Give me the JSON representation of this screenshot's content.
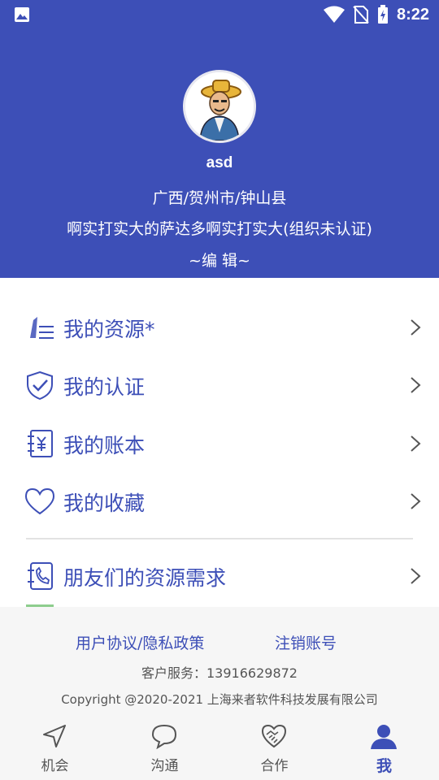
{
  "status_bar": {
    "time": "8:22",
    "left_icon": "image-icon",
    "right_icons": [
      "wifi-icon",
      "no-sim-icon",
      "battery-charging-icon"
    ]
  },
  "profile": {
    "username": "asd",
    "location": "广西/贺州市/钟山县",
    "organization": "啊实打实大的萨达多啊实打实大(组织未认证)",
    "edit_label": "~编 辑~"
  },
  "menu": [
    {
      "label": "我的资源*",
      "icon": "pen-list-icon"
    },
    {
      "label": "我的认证",
      "icon": "shield-check-icon"
    },
    {
      "label": "我的账本",
      "icon": "ledger-yen-icon"
    },
    {
      "label": "我的收藏",
      "icon": "heart-icon"
    },
    {
      "label": "朋友们的资源需求",
      "icon": "phone-contact-icon"
    }
  ],
  "footer": {
    "link_agreement": "用户协议/隐私政策",
    "link_cancel": "注销账号",
    "service": "客户服务：13916629872",
    "copyright": "Copyright @2020-2021 上海来者软件科技发展有限公司"
  },
  "nav": [
    {
      "label": "机会",
      "icon": "send-arrow-icon",
      "active": false
    },
    {
      "label": "沟通",
      "icon": "chat-bubble-icon",
      "active": false
    },
    {
      "label": "合作",
      "icon": "handshake-icon",
      "active": false
    },
    {
      "label": "我",
      "icon": "person-icon",
      "active": true
    }
  ],
  "colors": {
    "accent": "#3d4fb7",
    "background": "#ffffff",
    "footer_bg": "#f6f6f6"
  }
}
